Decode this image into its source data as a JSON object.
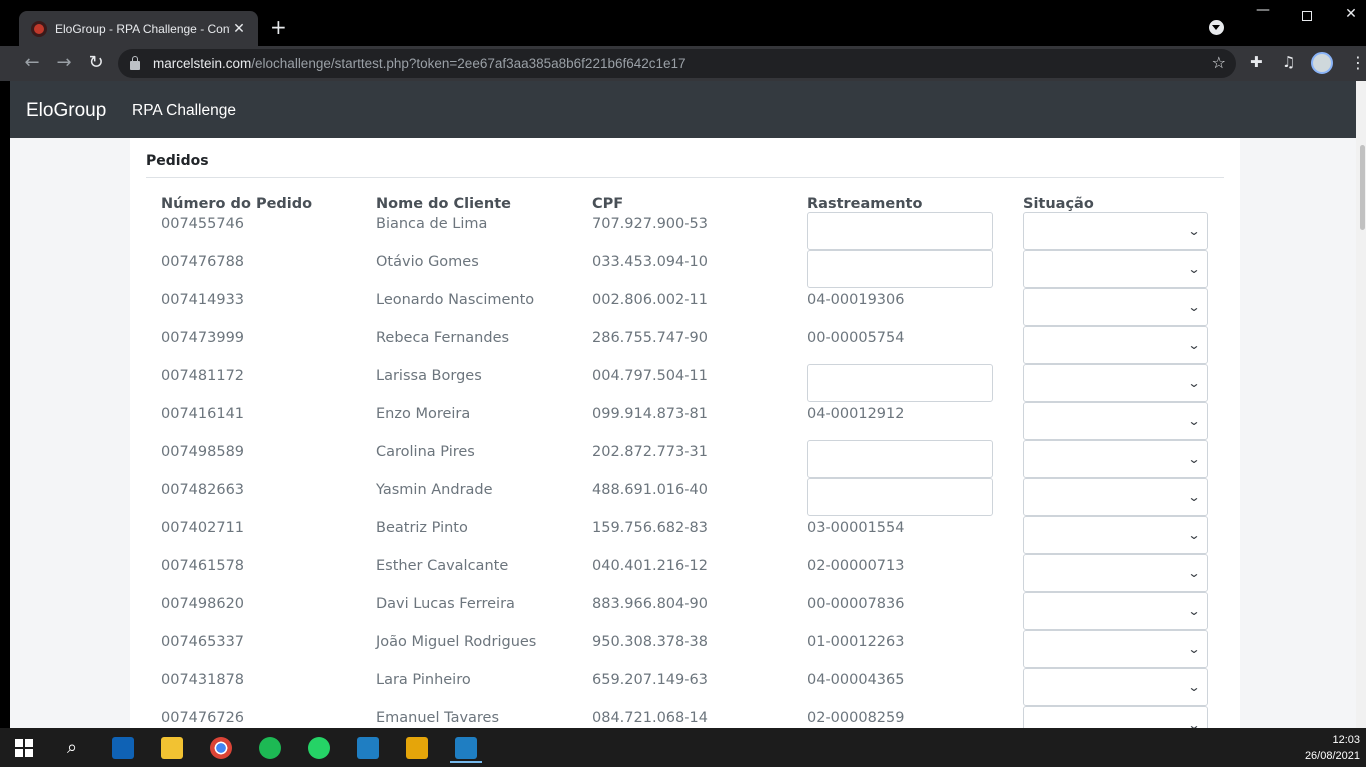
{
  "browser": {
    "tab_title": "EloGroup - RPA Challenge - Cont",
    "tab_close": "✕",
    "new_tab": "+",
    "url_host": "marcelstein.com",
    "url_path": "/elochallenge/starttest.php?token=2ee67af3aa385a8b6f221b6f642c1e17",
    "back": "←",
    "forward": "→",
    "reload": "↻",
    "star": "☆",
    "extensions": "✚",
    "media": "♫",
    "menu": "⋮",
    "minimize": "—",
    "close": "✕"
  },
  "app": {
    "brand": "EloGroup",
    "nav_link": "RPA Challenge"
  },
  "orders": {
    "card_title": "Pedidos",
    "headers": [
      "Número do Pedido",
      "Nome do Cliente",
      "CPF",
      "Rastreamento",
      "Situação"
    ],
    "rows": [
      {
        "numero": "007455746",
        "nome": "Bianca de Lima",
        "cpf": "707.927.900-53",
        "rastreamento": ""
      },
      {
        "numero": "007476788",
        "nome": "Otávio Gomes",
        "cpf": "033.453.094-10",
        "rastreamento": ""
      },
      {
        "numero": "007414933",
        "nome": "Leonardo Nascimento",
        "cpf": "002.806.002-11",
        "rastreamento": "04-00019306"
      },
      {
        "numero": "007473999",
        "nome": "Rebeca Fernandes",
        "cpf": "286.755.747-90",
        "rastreamento": "00-00005754"
      },
      {
        "numero": "007481172",
        "nome": "Larissa Borges",
        "cpf": "004.797.504-11",
        "rastreamento": ""
      },
      {
        "numero": "007416141",
        "nome": "Enzo Moreira",
        "cpf": "099.914.873-81",
        "rastreamento": "04-00012912"
      },
      {
        "numero": "007498589",
        "nome": "Carolina Pires",
        "cpf": "202.872.773-31",
        "rastreamento": ""
      },
      {
        "numero": "007482663",
        "nome": "Yasmin Andrade",
        "cpf": "488.691.016-40",
        "rastreamento": ""
      },
      {
        "numero": "007402711",
        "nome": "Beatriz Pinto",
        "cpf": "159.756.682-83",
        "rastreamento": "03-00001554"
      },
      {
        "numero": "007461578",
        "nome": "Esther Cavalcante",
        "cpf": "040.401.216-12",
        "rastreamento": "02-00000713"
      },
      {
        "numero": "007498620",
        "nome": "Davi Lucas Ferreira",
        "cpf": "883.966.804-90",
        "rastreamento": "00-00007836"
      },
      {
        "numero": "007465337",
        "nome": "João Miguel Rodrigues",
        "cpf": "950.308.378-38",
        "rastreamento": "01-00012263"
      },
      {
        "numero": "007431878",
        "nome": "Lara Pinheiro",
        "cpf": "659.207.149-63",
        "rastreamento": "04-00004365"
      },
      {
        "numero": "007476726",
        "nome": "Emanuel Tavares",
        "cpf": "084.721.068-14",
        "rastreamento": "02-00008259"
      }
    ]
  },
  "taskbar": {
    "apps": [
      "windows-start",
      "search",
      "outlook",
      "file-explorer",
      "chrome",
      "spotify",
      "whatsapp",
      "sisbr",
      "moving-truck-app",
      "sisbr-active"
    ],
    "time": "12:03",
    "date": "26/08/2021"
  }
}
